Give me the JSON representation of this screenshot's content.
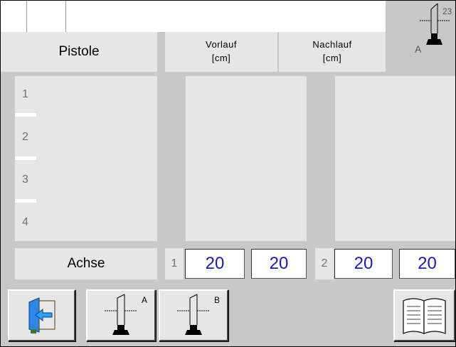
{
  "header": {
    "pistole_label": "Pistole",
    "vorlauf_line1": "Vorlauf",
    "vorlauf_line2": "[cm]",
    "nachlauf_line1": "Nachlauf",
    "nachlauf_line2": "[cm]",
    "axis_icon_label": "A",
    "axis_icon_number": "23"
  },
  "rows": [
    {
      "label": "1"
    },
    {
      "label": "2"
    },
    {
      "label": "3"
    },
    {
      "label": "4"
    }
  ],
  "achse": {
    "label": "Achse",
    "axis1_label": "1",
    "axis1_vorlauf": "20",
    "axis1_nachlauf": "20",
    "axis2_label": "2",
    "axis2_vorlauf": "20",
    "axis2_nachlauf": "20"
  },
  "toolbar": {
    "axis_a_label": "A",
    "axis_b_label": "B"
  },
  "icons": [
    "exit-icon",
    "axis-a-icon",
    "axis-b-icon",
    "manual-book-icon"
  ],
  "colors": {
    "value_text": "#1a1ab4",
    "panel": "#e6e6e6",
    "background": "#c8c8c8"
  }
}
